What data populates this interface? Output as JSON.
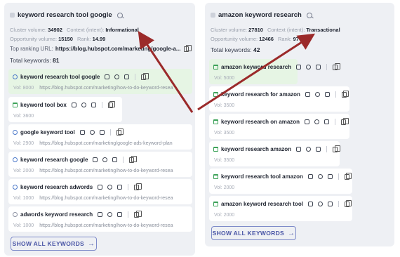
{
  "left": {
    "title": "keyword research tool google",
    "cluster_volume_label": "Cluster volume:",
    "cluster_volume": "34902",
    "context_label": "Context (intent):",
    "context": "Informational",
    "opportunity_label": "Opportunity volume:",
    "opportunity": "15150",
    "rank_label": "Rank:",
    "rank": "14.99",
    "url_label": "Top ranking URL:",
    "url": "https://blog.hubspot.com/marketing/google-a...",
    "total_label": "Total keywords:",
    "total": "81",
    "keywords": [
      {
        "name": "keyword research tool google",
        "vol": "Vol: 8000",
        "url": "https://blog.hubspot.com/marketing/how-to-do-keyword-resea",
        "intent": "search-icon"
      },
      {
        "name": "keyword tool box",
        "vol": "Vol: 3600",
        "url": "",
        "intent": "transactional-icon"
      },
      {
        "name": "google keyword tool",
        "vol": "Vol: 2900",
        "url": "https://blog.hubspot.com/marketing/google-ads-keyword-plan",
        "intent": "search-icon"
      },
      {
        "name": "keyword research google",
        "vol": "Vol: 2000",
        "url": "https://blog.hubspot.com/marketing/how-to-do-keyword-resea",
        "intent": "search-icon"
      },
      {
        "name": "keyword research adwords",
        "vol": "Vol: 1000",
        "url": "https://blog.hubspot.com/marketing/how-to-do-keyword-resea",
        "intent": "search-icon"
      },
      {
        "name": "adwords keyword research",
        "vol": "Vol: 1000",
        "url": "https://blog.hubspot.com/marketing/how-to-do-keyword-resea",
        "intent": "navigational-icon"
      }
    ],
    "show_all": "SHOW ALL KEYWORDS"
  },
  "right": {
    "title": "amazon keyword research",
    "cluster_volume_label": "Cluster volume:",
    "cluster_volume": "27810",
    "context_label": "Context (intent):",
    "context": "Transactional",
    "opportunity_label": "Opportunity volume:",
    "opportunity": "12466",
    "rank_label": "Rank:",
    "rank": "97",
    "total_label": "Total keywords:",
    "total": "42",
    "keywords": [
      {
        "name": "amazon keyword research",
        "vol": "Vol: 5000",
        "intent": "transactional-icon"
      },
      {
        "name": "keyword research for amazon",
        "vol": "Vol: 3500",
        "intent": "transactional-icon"
      },
      {
        "name": "keyword research on amazon",
        "vol": "Vol: 3500",
        "intent": "transactional-icon"
      },
      {
        "name": "keyword research amazon",
        "vol": "Vol: 3500",
        "intent": "transactional-icon"
      },
      {
        "name": "keyword research tool amazon",
        "vol": "Vol: 2000",
        "intent": "transactional-icon"
      },
      {
        "name": "amazon keyword research tool",
        "vol": "Vol: 2000",
        "intent": "transactional-icon"
      }
    ],
    "show_all": "SHOW ALL KEYWORDS"
  },
  "colors": {
    "arrow": "#9b2a2a",
    "highlight": "#e6f5e4",
    "button": "#4a56a6"
  }
}
